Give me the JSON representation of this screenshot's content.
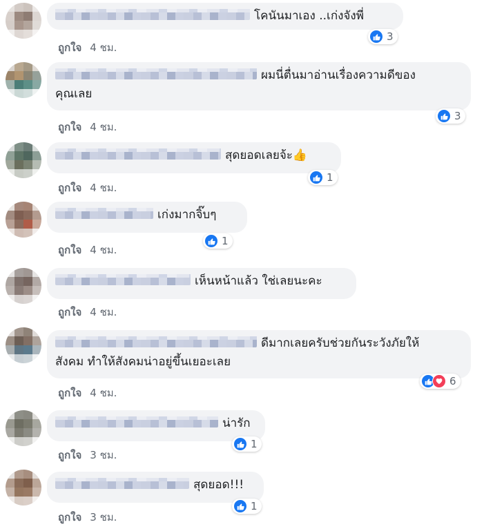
{
  "comments": [
    {
      "text": "โคนันมาเอง ..เก่งจังพี่",
      "reactions": "3",
      "like_label": "ถูกใจ",
      "time": "4 ชม."
    },
    {
      "text": "ผมนี่ตื่นมาอ่านเรื่องความดีของ",
      "text2": "คุณเลย",
      "reactions": "3",
      "like_label": "ถูกใจ",
      "time": "4 ชม."
    },
    {
      "text": "สุดยอดเลยจ้ะ👍",
      "reactions": "1",
      "like_label": "ถูกใจ",
      "time": "4 ชม."
    },
    {
      "text": "เก่งมากจิ๊บๆ",
      "reactions": "1",
      "like_label": "ถูกใจ",
      "time": "4 ชม."
    },
    {
      "text": "เห็นหน้าแล้ว ใช่เลยนะคะ",
      "reactions": "",
      "like_label": "ถูกใจ",
      "time": "4 ชม."
    },
    {
      "text": "ดีมากเลยครับช่วยกันระวังภัยให้",
      "text2": "สังคม ทำให้สังคมน่าอยู่ขึ้นเยอะเลย",
      "reactions": "6",
      "like_label": "ถูกใจ",
      "time": "4 ชม."
    },
    {
      "text": "น่ารัก",
      "reactions": "1",
      "like_label": "ถูกใจ",
      "time": "3 ชม."
    },
    {
      "text": "สุดยอด!!!",
      "reactions": "1",
      "like_label": "ถูกใจ",
      "time": "3 ชม."
    }
  ],
  "separator": "·",
  "icons": {
    "like": "thumbs-up-icon",
    "love": "heart-icon"
  },
  "colors": {
    "like": "#1877f2",
    "love": "#f33e58",
    "bubble": "#f2f3f5",
    "meta": "#606770"
  }
}
